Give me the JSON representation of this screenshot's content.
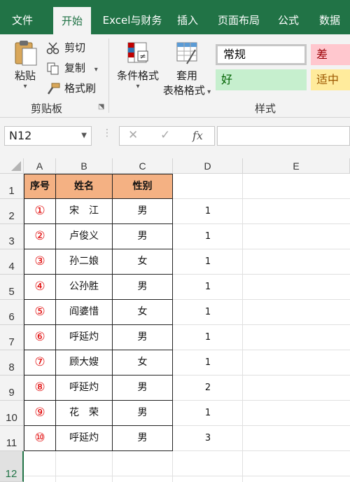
{
  "ribbon_tabs": [
    "文件",
    "开始",
    "Excel与财务",
    "插入",
    "页面布局",
    "公式",
    "数据"
  ],
  "clipboard": {
    "paste": "粘贴",
    "cut": "剪切",
    "copy": "复制",
    "format_painter": "格式刷",
    "group_label": "剪贴板"
  },
  "styles_group": {
    "conditional_format": "条件格式",
    "table_format_1": "套用",
    "table_format_2": "表格格式",
    "normal": "常规",
    "bad": "差",
    "good": "好",
    "neutral": "适中",
    "group_label": "样式"
  },
  "formula_bar": {
    "name_box": "N12",
    "fx": "fx",
    "cancel": "✕",
    "enter": "✓"
  },
  "columns": [
    "A",
    "B",
    "C",
    "D",
    "E"
  ],
  "rows": [
    "1",
    "2",
    "3",
    "4",
    "5",
    "6",
    "7",
    "8",
    "9",
    "10",
    "11",
    "12"
  ],
  "table": {
    "headers": [
      "序号",
      "姓名",
      "性别"
    ],
    "records": [
      {
        "no": "①",
        "name": "宋　江",
        "gender": "男",
        "d": "1"
      },
      {
        "no": "②",
        "name": "卢俊义",
        "gender": "男",
        "d": "1"
      },
      {
        "no": "③",
        "name": "孙二娘",
        "gender": "女",
        "d": "1"
      },
      {
        "no": "④",
        "name": "公孙胜",
        "gender": "男",
        "d": "1"
      },
      {
        "no": "⑤",
        "name": "阎婆惜",
        "gender": "女",
        "d": "1"
      },
      {
        "no": "⑥",
        "name": "呼延灼",
        "gender": "男",
        "d": "1"
      },
      {
        "no": "⑦",
        "name": "顾大嫂",
        "gender": "女",
        "d": "1"
      },
      {
        "no": "⑧",
        "name": "呼延灼",
        "gender": "男",
        "d": "2"
      },
      {
        "no": "⑨",
        "name": "花　荣",
        "gender": "男",
        "d": "1"
      },
      {
        "no": "⑩",
        "name": "呼延灼",
        "gender": "男",
        "d": "3"
      }
    ]
  },
  "colors": {
    "accent": "#217346",
    "header_fill": "#f4b183",
    "number_red": "#e00000",
    "bad_fill": "#ffc7ce",
    "good_fill": "#c6efce",
    "neutral_fill": "#ffeb9c"
  }
}
